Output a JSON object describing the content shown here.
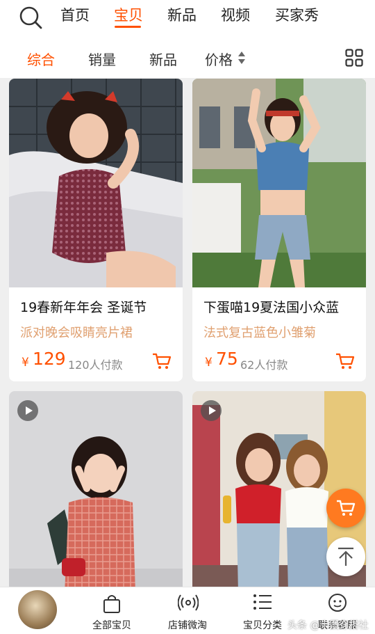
{
  "top_nav": {
    "tabs": [
      "首页",
      "宝贝",
      "新品",
      "视频",
      "买家秀"
    ],
    "active_tab": "宝贝"
  },
  "sort_bar": {
    "options": [
      "综合",
      "销量",
      "新品",
      "价格"
    ],
    "active": "综合"
  },
  "products": [
    {
      "title": "19春新年年会 圣诞节",
      "subtitle": "派对晚会吸睛亮片裙",
      "price": "129",
      "currency": "¥",
      "sold": "120人付款"
    },
    {
      "title": "下蛋喵19夏法国小众蓝",
      "subtitle": "法式复古蓝色小雏菊",
      "price": "75",
      "currency": "¥",
      "sold": "62人付款"
    }
  ],
  "bottom_bar": {
    "items": [
      "全部宝贝",
      "店铺微淘",
      "宝贝分类",
      "联系客服"
    ]
  },
  "watermark": "头条 @卡图穿搭社",
  "colors": {
    "accent": "#ff5000",
    "subtitle": "#e0a070",
    "fab": "#ff7a20"
  },
  "icons": [
    "search-icon",
    "grid-view-icon",
    "sort-arrows-icon",
    "cart-icon",
    "play-icon",
    "back-to-top-icon",
    "bag-icon",
    "broadcast-icon",
    "list-icon",
    "service-face-icon"
  ]
}
